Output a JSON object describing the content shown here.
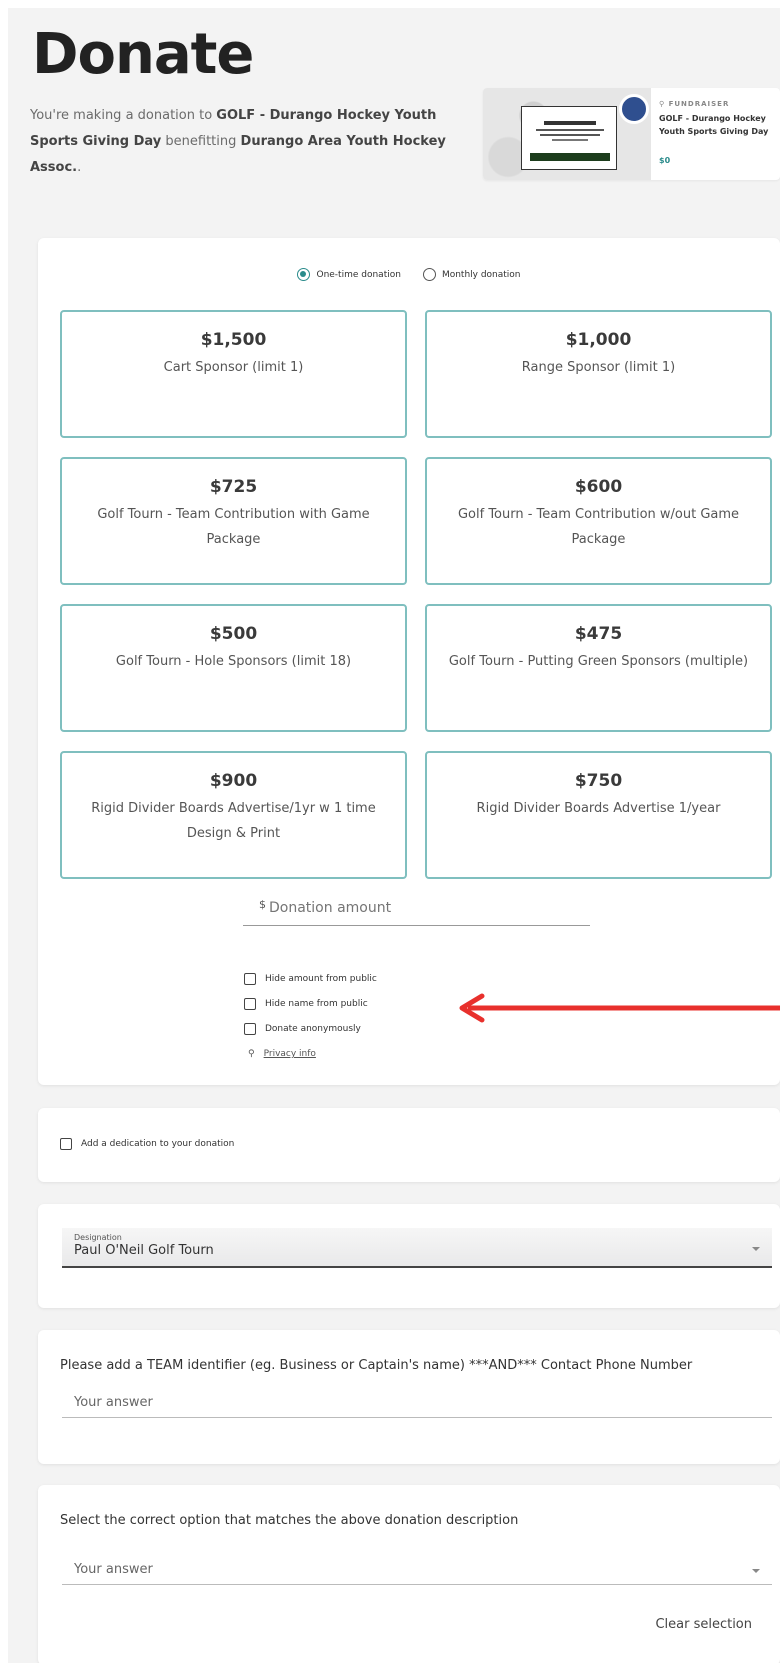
{
  "page": {
    "title": "Donate",
    "intro": {
      "prefix": "You're making a donation to ",
      "fundraiser": "GOLF - Durango Hockey Youth Sports Giving Day",
      "middle": " benefitting ",
      "org": "Durango Area Youth Hockey Assoc.",
      "suffix": "."
    }
  },
  "fundraiser_card": {
    "label": "FUNDRAISER",
    "name_line1": "GOLF - Durango Hockey",
    "name_line2": "Youth Sports Giving Day",
    "amount": "$0"
  },
  "frequency": {
    "one_time": "One-time donation",
    "monthly": "Monthly donation",
    "selected": "one_time"
  },
  "tiers": [
    {
      "amount": "$1,500",
      "description": "Cart Sponsor (limit 1)"
    },
    {
      "amount": "$1,000",
      "description": "Range Sponsor (limit 1)"
    },
    {
      "amount": "$725",
      "description": "Golf Tourn - Team Contribution with Game Package"
    },
    {
      "amount": "$600",
      "description": "Golf Tourn - Team Contribution w/out Game Package"
    },
    {
      "amount": "$500",
      "description": "Golf Tourn - Hole Sponsors (limit 18)"
    },
    {
      "amount": "$475",
      "description": "Golf Tourn - Putting Green Sponsors (multiple)"
    },
    {
      "amount": "$900",
      "description": "Rigid Divider Boards Advertise/1yr w 1 time Design & Print"
    },
    {
      "amount": "$750",
      "description": "Rigid Divider Boards Advertise 1/year"
    }
  ],
  "amount_field": {
    "currency": "$",
    "placeholder": "Donation amount"
  },
  "options": {
    "hide_amount": "Hide amount from public",
    "hide_name": "Hide name from public",
    "anonymous": "Donate anonymously",
    "privacy": "Privacy info"
  },
  "dedication": {
    "label": "Add a dedication to your donation"
  },
  "designation": {
    "label": "Designation",
    "value": "Paul O'Neil Golf Tourn"
  },
  "team_question": {
    "label": "Please add a TEAM identifier (eg. Business or Captain's name) ***AND*** Contact Phone Number",
    "placeholder": "Your answer"
  },
  "select_question": {
    "label": "Select the correct option that matches the above donation description",
    "placeholder": "Your answer",
    "clear": "Clear selection"
  },
  "colors": {
    "accent": "#2a8b8b",
    "tier_border": "#7fbfbf",
    "arrow": "#e8302c"
  }
}
